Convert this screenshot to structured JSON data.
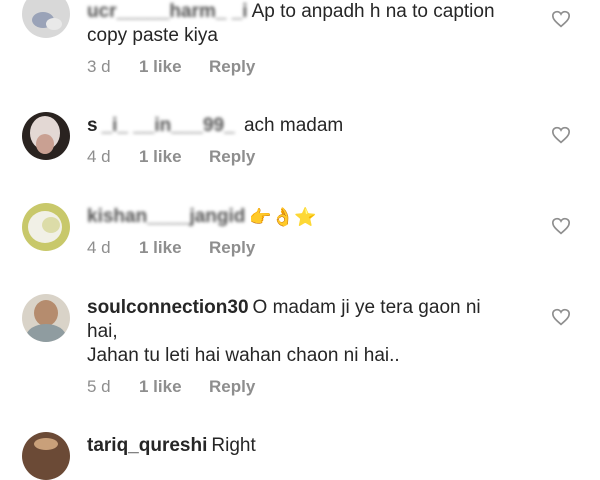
{
  "comments": [
    {
      "username_visible": "",
      "username_obscured": "ucr_____harm_ _i",
      "text": "Ap to anpadh h na to caption copy paste kiya",
      "text_line1": "Ap to anpadh h na to caption",
      "text_line2": "copy paste kiya",
      "age": "3 d",
      "likes": "1 like",
      "reply": "Reply"
    },
    {
      "username_visible": "s",
      "username_obscured": "_i_ __in___99_ ",
      "text": "ach madam",
      "age": "4 d",
      "likes": "1 like",
      "reply": "Reply"
    },
    {
      "username_visible": "",
      "username_obscured": "kishan____jangid",
      "text": "",
      "emoji": "👉👌⭐",
      "age": "4 d",
      "likes": "1 like",
      "reply": "Reply"
    },
    {
      "username_visible": "soulconnection30",
      "text_line1": "O madam ji ye tera gaon ni",
      "text_line2": "hai,",
      "text_line3": "Jahan tu leti hai wahan chaon ni hai..",
      "age": "5 d",
      "likes": "1 like",
      "reply": "Reply"
    },
    {
      "username_visible": "tariq_qureshi",
      "text": "Right"
    }
  ],
  "icons": {
    "like": "heart-outline-icon"
  },
  "colors": {
    "text": "#262626",
    "meta": "#8e8e8e",
    "icon": "#8e8e8e"
  }
}
